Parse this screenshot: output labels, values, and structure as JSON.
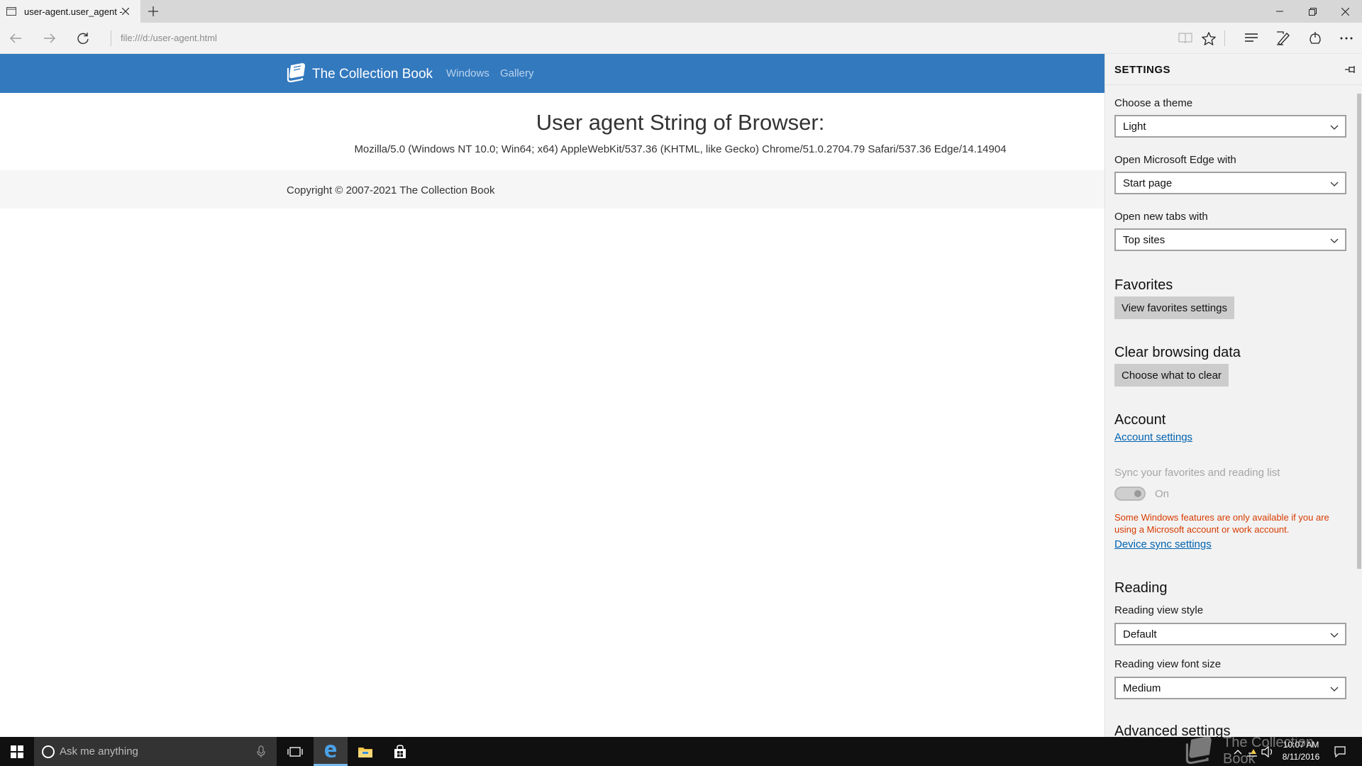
{
  "browser": {
    "tab": {
      "title": "user-agent.user_agent -",
      "favicon": "page-icon"
    },
    "url": "file:///d:/user-agent.html",
    "window_controls": [
      "minimize-icon",
      "restore-icon",
      "close-icon"
    ],
    "toolbar_icons": [
      "reading-view-icon",
      "favorites-star-icon",
      "hub-icon",
      "web-note-icon",
      "share-icon",
      "more-icon"
    ]
  },
  "site": {
    "brand": "The Collection Book",
    "nav": [
      "Windows",
      "Gallery"
    ],
    "heading": "User agent String of Browser:",
    "user_agent": "Mozilla/5.0 (Windows NT 10.0; Win64; x64) AppleWebKit/537.36 (KHTML, like Gecko) Chrome/51.0.2704.79 Safari/537.36 Edge/14.14904",
    "copyright": "Copyright © 2007-2021 The Collection Book"
  },
  "settings": {
    "title": "SETTINGS",
    "theme": {
      "label": "Choose a theme",
      "value": "Light"
    },
    "open_with": {
      "label": "Open Microsoft Edge with",
      "value": "Start page"
    },
    "new_tabs": {
      "label": "Open new tabs with",
      "value": "Top sites"
    },
    "favorites": {
      "title": "Favorites",
      "button": "View favorites settings"
    },
    "clear_data": {
      "title": "Clear browsing data",
      "button": "Choose what to clear"
    },
    "account": {
      "title": "Account",
      "link": "Account settings",
      "sync_label": "Sync your favorites and reading list",
      "sync_state": "On",
      "warning": "Some Windows features are only available if you are using a Microsoft account or work account.",
      "device_sync_link": "Device sync settings"
    },
    "reading": {
      "title": "Reading",
      "style_label": "Reading view style",
      "style_value": "Default",
      "font_label": "Reading view font size",
      "font_value": "Medium"
    },
    "advanced_title": "Advanced settings"
  },
  "taskbar": {
    "search_placeholder": "Ask me anything",
    "time": "10:07 AM",
    "date": "8/11/2016",
    "watermark": "The Collection Book",
    "accent": "#76b9ed"
  },
  "colors": {
    "site_nav": "#3379be",
    "link": "#0063b1",
    "warning": "#d83b01"
  }
}
